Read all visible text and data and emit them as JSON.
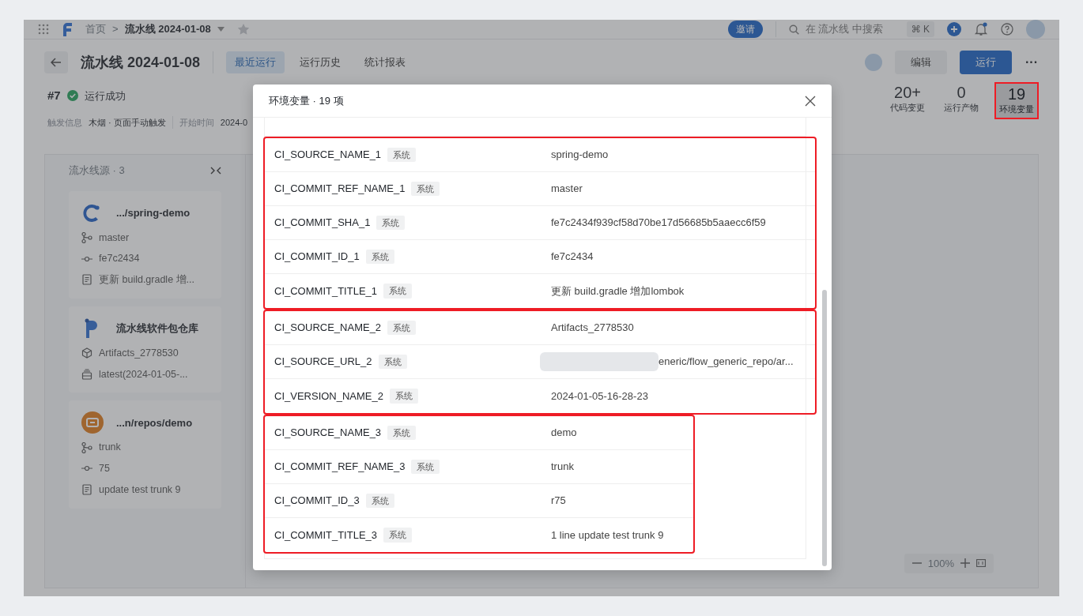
{
  "topbar": {
    "home": "首页",
    "separator": ">",
    "pipeline": "流水线 2024-01-08",
    "invite": "邀请",
    "search": {
      "placeholder": "在 流水线 中搜索"
    },
    "shortcut": "⌘ K",
    "notification_dot": true
  },
  "header": {
    "title": "流水线 2024-01-08",
    "tabs": [
      {
        "label": "最近运行",
        "selected": true
      },
      {
        "label": "运行历史",
        "selected": false
      },
      {
        "label": "统计报表",
        "selected": false
      }
    ],
    "edit_button": "编辑",
    "run_button": "运行",
    "more": "···"
  },
  "run": {
    "number": "#7",
    "status": "运行成功",
    "trigger_label": "触发信息",
    "trigger": "木烟 · 页面手动触发",
    "start_label": "开始时间",
    "start": "2024-0"
  },
  "stats": [
    {
      "value": "20+",
      "label": "代码变更",
      "highlighted": false
    },
    {
      "value": "0",
      "label": "运行产物",
      "highlighted": false
    },
    {
      "value": "19",
      "label": "环境变量",
      "highlighted": true
    }
  ],
  "sources": {
    "title": "流水线源 · 3",
    "cards": [
      {
        "kind": "codeup",
        "name": ".../spring-demo",
        "lines": [
          {
            "kind": "branch",
            "text": "master"
          },
          {
            "kind": "commit",
            "text": "fe7c2434"
          },
          {
            "kind": "message",
            "text": "更新 build.gradle 增..."
          }
        ]
      },
      {
        "kind": "package",
        "name": "流水线软件包仓库",
        "lines": [
          {
            "kind": "artifact",
            "text": "Artifacts_2778530"
          },
          {
            "kind": "version",
            "text": "latest(2024-01-05-..."
          }
        ]
      },
      {
        "kind": "svn",
        "name": "...n/repos/demo",
        "lines": [
          {
            "kind": "branch",
            "text": "trunk"
          },
          {
            "kind": "commit",
            "text": "75"
          },
          {
            "kind": "message",
            "text": "update test trunk 9"
          }
        ]
      }
    ]
  },
  "zoom": {
    "value": "100%"
  },
  "modal": {
    "title": "环境变量 · 19 项",
    "groups": [
      {
        "highlighted": true,
        "rows": [
          {
            "name": "CI_SOURCE_NAME_1",
            "tag": "系统",
            "value": "spring-demo",
            "redacted": false
          },
          {
            "name": "CI_COMMIT_REF_NAME_1",
            "tag": "系统",
            "value": "master",
            "redacted": false
          },
          {
            "name": "CI_COMMIT_SHA_1",
            "tag": "系统",
            "value": "fe7c2434f939cf58d70be17d56685b5aaecc6f59",
            "redacted": false
          },
          {
            "name": "CI_COMMIT_ID_1",
            "tag": "系统",
            "value": "fe7c2434",
            "redacted": false
          },
          {
            "name": "CI_COMMIT_TITLE_1",
            "tag": "系统",
            "value": "更新 build.gradle 增加lombok",
            "redacted": false
          }
        ]
      },
      {
        "highlighted": true,
        "rows": [
          {
            "name": "CI_SOURCE_NAME_2",
            "tag": "系统",
            "value": "Artifacts_2778530",
            "redacted": false
          },
          {
            "name": "CI_SOURCE_URL_2",
            "tag": "系统",
            "value": "eneric/flow_generic_repo/ar...",
            "redacted": true
          },
          {
            "name": "CI_VERSION_NAME_2",
            "tag": "系统",
            "value": "2024-01-05-16-28-23",
            "redacted": false
          }
        ]
      },
      {
        "highlighted": true,
        "rows": [
          {
            "name": "CI_SOURCE_NAME_3",
            "tag": "系统",
            "value": "demo",
            "redacted": false
          },
          {
            "name": "CI_COMMIT_REF_NAME_3",
            "tag": "系统",
            "value": "trunk",
            "redacted": false
          },
          {
            "name": "CI_COMMIT_ID_3",
            "tag": "系统",
            "value": "r75",
            "redacted": false
          },
          {
            "name": "CI_COMMIT_TITLE_3",
            "tag": "系统",
            "value": "1 line update test trunk 9",
            "redacted": false
          }
        ]
      }
    ]
  }
}
